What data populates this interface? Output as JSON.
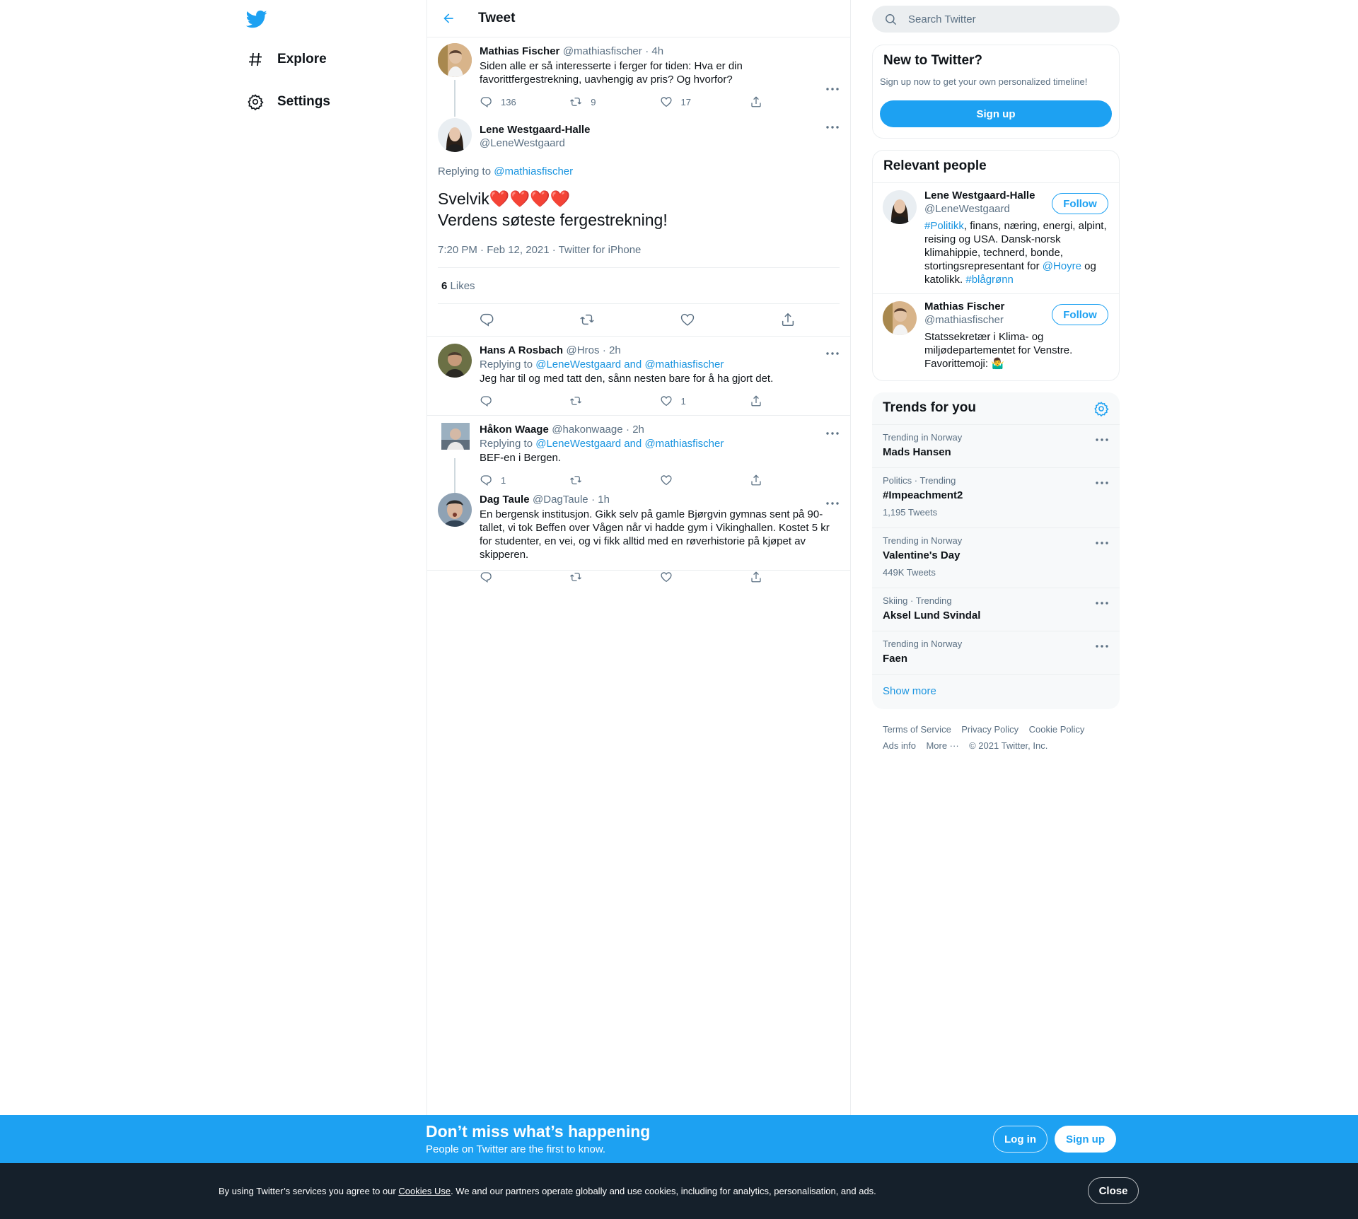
{
  "nav": {
    "explore": "Explore",
    "settings": "Settings"
  },
  "header": {
    "title": "Tweet"
  },
  "parent_tweet": {
    "name": "Mathias Fischer",
    "handle": "@mathiasfischer",
    "time": "· 4h",
    "text": "Siden alle er så interesserte i ferger for tiden: Hva er din favorittfergestrekning, uavhengig av pris? Og hvorfor?",
    "replies": "136",
    "retweets": "9",
    "likes": "17"
  },
  "main_tweet": {
    "name": "Lene Westgaard-Halle",
    "handle": "@LeneWestgaard",
    "replying_prefix": "Replying to",
    "replying_to": "@mathiasfischer",
    "line1": "Svelvik❤️❤️❤️❤️",
    "line2": "Verdens søteste fergestrekning!",
    "timestamp": "7:20 PM · Feb 12, 2021 · Twitter for iPhone",
    "likes_count": "6",
    "likes_label": "Likes"
  },
  "replies": [
    {
      "name": "Hans A Rosbach",
      "handle": "@Hros",
      "time": "· 2h",
      "replying_prefix": "Replying to",
      "replying_to": "@LeneWestgaard and @mathiasfischer",
      "text": "Jeg har til og med tatt den, sånn nesten bare for å ha gjort det.",
      "replies": "",
      "retweets": "",
      "likes": "1"
    },
    {
      "name": "Håkon Waage",
      "handle": "@hakonwaage",
      "time": "· 2h",
      "replying_prefix": "Replying to",
      "replying_to": "@LeneWestgaard and @mathiasfischer",
      "text": "BEF-en i Bergen.",
      "replies": "1",
      "retweets": "",
      "likes": ""
    },
    {
      "name": "Dag Taule",
      "handle": "@DagTaule",
      "time": "· 1h",
      "text": "En bergensk institusjon. Gikk selv på gamle Bjørgvin gymnas sent på 90-tallet, vi tok Beffen over Vågen når vi hadde gym i Vikinghallen. Kostet 5 kr for studenter, en vei, og vi fikk alltid med en røverhistorie på kjøpet av skipperen.",
      "replies": "",
      "retweets": "",
      "likes": ""
    }
  ],
  "search": {
    "placeholder": "Search Twitter"
  },
  "new_to_twitter": {
    "title": "New to Twitter?",
    "subtitle": "Sign up now to get your own personalized timeline!",
    "button": "Sign up"
  },
  "relevant_people": {
    "title": "Relevant people",
    "follow_label": "Follow",
    "people": [
      {
        "name": "Lene Westgaard-Halle",
        "handle": "@LeneWestgaard",
        "bio_tag1": "#Politikk",
        "bio_mid": ", finans, næring, energi, alpint, reising og USA. Dansk-norsk klimahippie, technerd, bonde, stortingsrepresentant for ",
        "bio_tag2": "@Hoyre",
        "bio_end": " og katolikk. ",
        "bio_tag3": "#blågrønn"
      },
      {
        "name": "Mathias Fischer",
        "handle": "@mathiasfischer",
        "bio": "Statssekretær i Klima- og miljødepartementet for Venstre. Favorittemoji: 🤷‍♂️"
      }
    ]
  },
  "trends": {
    "title": "Trends for you",
    "items": [
      {
        "meta": "Trending in Norway",
        "name": "Mads Hansen",
        "count": ""
      },
      {
        "meta": "Politics · Trending",
        "name": "#Impeachment2",
        "count": "1,195 Tweets"
      },
      {
        "meta": "Trending in Norway",
        "name": "Valentine's Day",
        "count": "449K Tweets"
      },
      {
        "meta": "Skiing · Trending",
        "name": "Aksel Lund Svindal",
        "count": ""
      },
      {
        "meta": "Trending in Norway",
        "name": "Faen",
        "count": ""
      }
    ],
    "show_more": "Show more"
  },
  "footer": {
    "terms": "Terms of Service",
    "privacy": "Privacy Policy",
    "cookie": "Cookie Policy",
    "ads": "Ads info",
    "more": "More ···",
    "copyright": "© 2021 Twitter, Inc."
  },
  "bottom_bar": {
    "headline": "Don’t miss what’s happening",
    "sub": "People on Twitter are the first to know.",
    "login": "Log in",
    "signup": "Sign up"
  },
  "cookie_bar": {
    "text_before": "By using Twitter’s services you agree to our ",
    "link": "Cookies Use",
    "text_after": ". We and our partners operate globally and use cookies, including for analytics, personalisation, and ads.",
    "close": "Close"
  },
  "colors": {
    "accent": "#1da1f2",
    "link": "#1b95e0",
    "secondary_text": "#5b7083",
    "border": "#ebeef0",
    "cookie_bg": "#15202b"
  }
}
